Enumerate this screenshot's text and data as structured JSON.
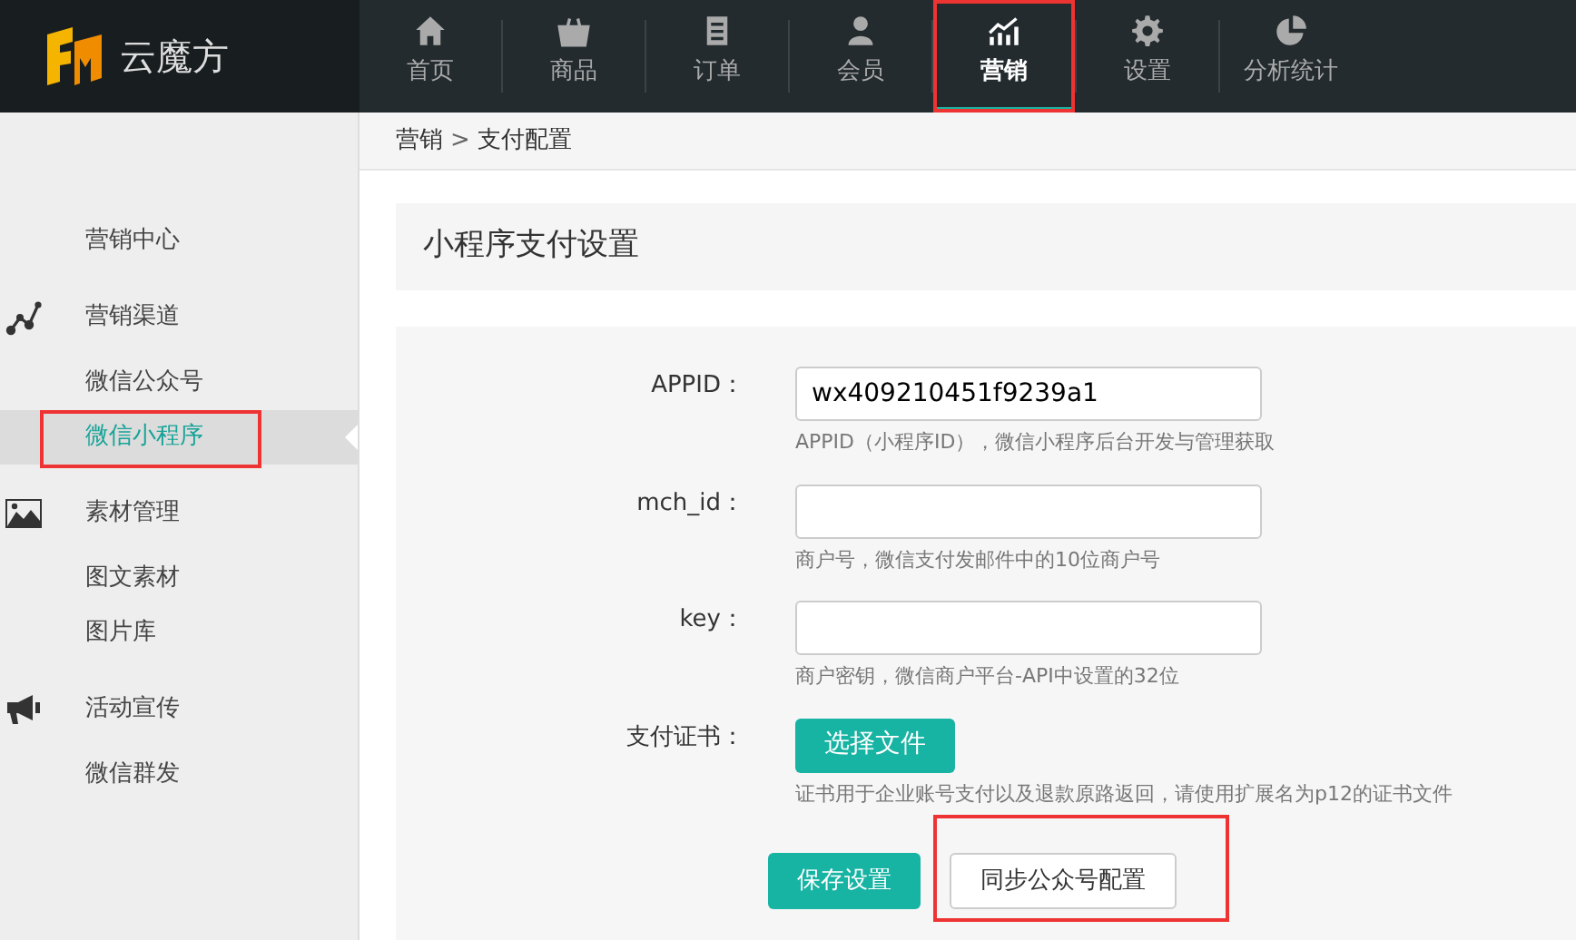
{
  "logo": {
    "text": "云魔方"
  },
  "nav": [
    {
      "label": "首页",
      "selected": false,
      "highlighted": false
    },
    {
      "label": "商品",
      "selected": false,
      "highlighted": false
    },
    {
      "label": "订单",
      "selected": false,
      "highlighted": false
    },
    {
      "label": "会员",
      "selected": false,
      "highlighted": false
    },
    {
      "label": "营销",
      "selected": true,
      "highlighted": true
    },
    {
      "label": "设置",
      "selected": false,
      "highlighted": false
    },
    {
      "label": "分析统计",
      "selected": false,
      "highlighted": false
    }
  ],
  "breadcrumb": {
    "items": [
      "营销",
      "支付配置"
    ],
    "separator": ">"
  },
  "sidebar": [
    {
      "label": "营销中心",
      "kind": "link",
      "selected": false,
      "highlighted": false
    },
    {
      "label": "营销渠道",
      "kind": "section",
      "children": [
        {
          "label": "微信公众号",
          "selected": false,
          "highlighted": false
        },
        {
          "label": "微信小程序",
          "selected": true,
          "highlighted": true
        }
      ]
    },
    {
      "label": "素材管理",
      "kind": "section",
      "children": [
        {
          "label": "图文素材",
          "selected": false,
          "highlighted": false
        },
        {
          "label": "图片库",
          "selected": false,
          "highlighted": false
        }
      ]
    },
    {
      "label": "活动宣传",
      "kind": "section",
      "children": [
        {
          "label": "微信群发",
          "selected": false,
          "highlighted": false
        }
      ]
    }
  ],
  "page_title": "小程序支付设置",
  "form": {
    "fields": [
      {
        "kind": "text",
        "label": "APPID：",
        "value": "wx409210451f9239a1",
        "help": "APPID（小程序ID），微信小程序后台开发与管理获取"
      },
      {
        "kind": "text",
        "label": "mch_id：",
        "help": "商户号，微信支付发邮件中的10位商户号"
      },
      {
        "kind": "text",
        "label": "key：",
        "help": "商户密钥，微信商户平台-API中设置的32位"
      },
      {
        "kind": "file",
        "label": "支付证书：",
        "button": "选择文件",
        "help": "证书用于企业账号支付以及退款原路返回，请使用扩展名为p12的证书文件"
      }
    ],
    "buttons": [
      {
        "label": "保存设置",
        "kind": "primary",
        "highlighted": false
      },
      {
        "label": "同步公众号配置",
        "kind": "default",
        "highlighted": true
      }
    ]
  }
}
